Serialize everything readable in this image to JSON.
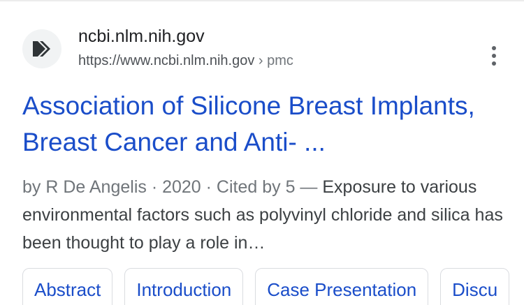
{
  "result": {
    "site_name": "ncbi.nlm.nih.gov",
    "url": "https://www.ncbi.nlm.nih.gov",
    "breadcrumb_separator": "›",
    "breadcrumb": "pmc",
    "title": "Association of Silicone Breast Implants, Breast Cancer and Anti- ...",
    "snippet_meta": "by R De Angelis · 2020 · Cited by 5 — ",
    "snippet_text": "Exposure to various environmental factors such as polyvinyl chloride and silica has been thought to play a role in…",
    "favicon_icon": "ncbi-chevron-icon",
    "menu_icon": "more-vert-icon",
    "sitelinks": [
      "Abstract",
      "Introduction",
      "Case Presentation",
      "Discu"
    ]
  },
  "colors": {
    "title_link": "#1a4dc9",
    "body_text": "#3c4043",
    "meta_text": "#70757a",
    "favicon_bg": "#f1f3f4",
    "favicon_fg": "#2f3437"
  }
}
